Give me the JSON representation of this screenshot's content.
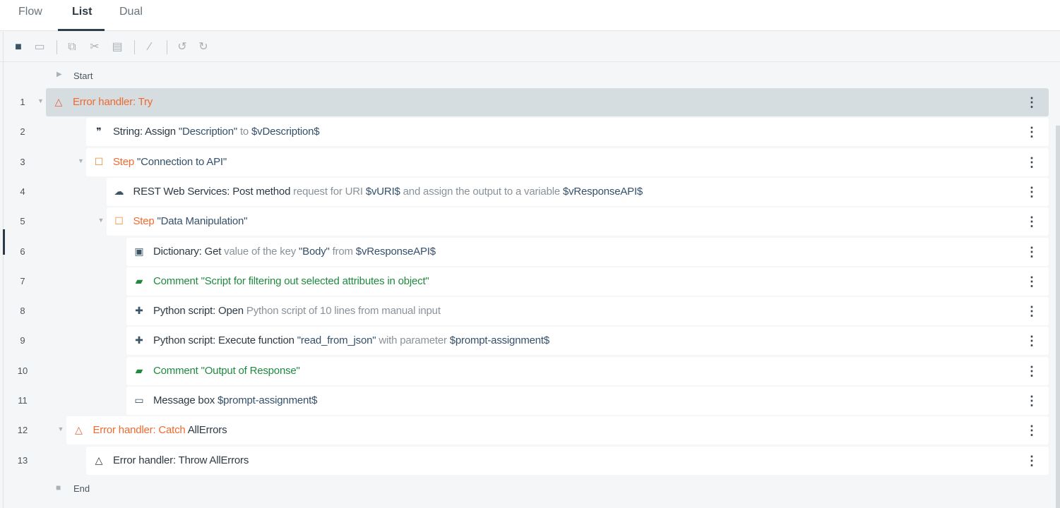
{
  "tabs": [
    {
      "label": "Flow"
    },
    {
      "label": "List",
      "active": true
    },
    {
      "label": "Dual"
    }
  ],
  "toolbar": [
    "record-icon",
    "screen-capture-icon",
    "copy-icon",
    "cut-icon",
    "paste-icon",
    "disable-icon",
    "undo-icon",
    "redo-icon"
  ],
  "start_label": "Start",
  "end_label": "End",
  "rows": [
    {
      "n": "1",
      "level": 0,
      "caret": true,
      "selected": true,
      "icon": "warning-triangle",
      "segs": [
        {
          "t": "Error handler: Try",
          "s": "orange"
        }
      ]
    },
    {
      "n": "2",
      "level": 2,
      "icon": "quote",
      "segs": [
        {
          "t": "String: Assign ",
          "s": "strong"
        },
        {
          "t": "\"Description\"",
          "s": "var"
        },
        {
          "t": " to ",
          "s": "light"
        },
        {
          "t": "$vDescription$",
          "s": "var"
        }
      ]
    },
    {
      "n": "3",
      "level": 2,
      "caret": true,
      "icon": "step",
      "segs": [
        {
          "t": "Step ",
          "s": "orange"
        },
        {
          "t": "\"Connection to API\"",
          "s": "var"
        }
      ]
    },
    {
      "n": "4",
      "level": 3,
      "icon": "cloud",
      "segs": [
        {
          "t": "REST Web Services: Post method",
          "s": "strong"
        },
        {
          "t": " request for URI ",
          "s": "light"
        },
        {
          "t": "$vURI$",
          "s": "var"
        },
        {
          "t": " and assign the output to a variable ",
          "s": "light"
        },
        {
          "t": "$vResponseAPI$",
          "s": "var"
        }
      ]
    },
    {
      "n": "5",
      "level": 3,
      "caret": true,
      "icon": "step",
      "segs": [
        {
          "t": "Step ",
          "s": "orange"
        },
        {
          "t": "\"Data Manipulation\"",
          "s": "var"
        }
      ]
    },
    {
      "n": "6",
      "level": 4,
      "icon": "dictionary",
      "segs": [
        {
          "t": "Dictionary: Get",
          "s": "strong"
        },
        {
          "t": " value of the key ",
          "s": "light"
        },
        {
          "t": "\"Body\"",
          "s": "var"
        },
        {
          "t": " from ",
          "s": "light"
        },
        {
          "t": "$vResponseAPI$",
          "s": "var"
        }
      ]
    },
    {
      "n": "7",
      "level": 4,
      "icon": "comment",
      "segs": [
        {
          "t": "Comment \"Script for filtering out selected attributes in object\"",
          "s": "green"
        }
      ]
    },
    {
      "n": "8",
      "level": 4,
      "icon": "python",
      "segs": [
        {
          "t": "Python script: Open",
          "s": "strong"
        },
        {
          "t": " Python script of 10 lines from manual input",
          "s": "light"
        }
      ]
    },
    {
      "n": "9",
      "level": 4,
      "icon": "python",
      "segs": [
        {
          "t": "Python script: Execute function ",
          "s": "strong"
        },
        {
          "t": "\"read_from_json\"",
          "s": "var"
        },
        {
          "t": " with parameter ",
          "s": "light"
        },
        {
          "t": "$prompt-assignment$",
          "s": "var"
        }
      ]
    },
    {
      "n": "10",
      "level": 4,
      "icon": "comment",
      "segs": [
        {
          "t": "Comment \"Output of Response\"",
          "s": "green"
        }
      ]
    },
    {
      "n": "11",
      "level": 4,
      "icon": "message-box",
      "segs": [
        {
          "t": "Message box ",
          "s": "strong"
        },
        {
          "t": "$prompt-assignment$",
          "s": "var"
        }
      ]
    },
    {
      "n": "12",
      "level": 1,
      "caret": true,
      "icon": "warning-triangle",
      "segs": [
        {
          "t": "Error handler: Catch ",
          "s": "orange"
        },
        {
          "t": "AllErrors",
          "s": "strong"
        }
      ]
    },
    {
      "n": "13",
      "level": 2,
      "icon": "throw-triangle",
      "segs": [
        {
          "t": "Error handler: Throw AllErrors",
          "s": "strong"
        }
      ]
    }
  ],
  "colors": {
    "orange": "#ef6a2e",
    "green": "#1f8a3e",
    "var": "#34506a",
    "selected": "#d6dde0"
  }
}
